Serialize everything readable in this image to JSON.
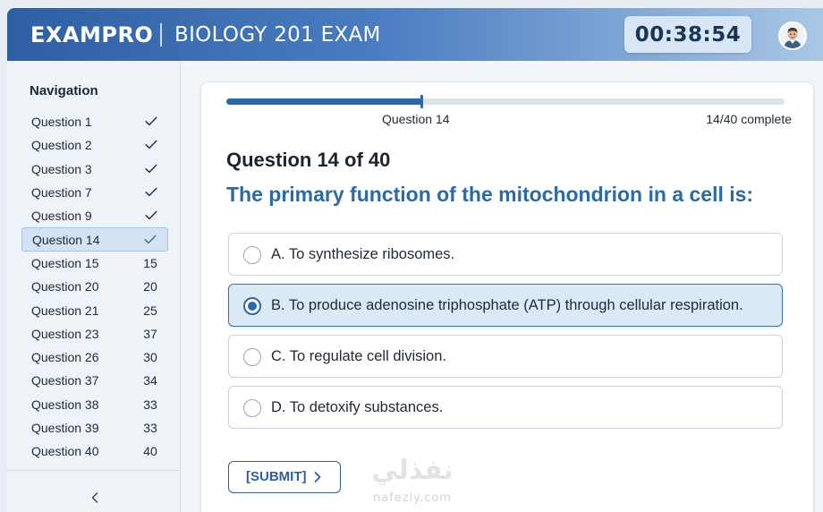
{
  "header": {
    "brand": "EXAMPRO",
    "exam_title": "BIOLOGY 201 EXAM",
    "timer": "00:38:54"
  },
  "sidebar": {
    "title": "Navigation",
    "items": [
      {
        "label": "Question 1",
        "status": "check",
        "value": ""
      },
      {
        "label": "Question 2",
        "status": "check",
        "value": ""
      },
      {
        "label": "Question 3",
        "status": "check",
        "value": ""
      },
      {
        "label": "Question 7",
        "status": "check",
        "value": ""
      },
      {
        "label": "Question 9",
        "status": "check",
        "value": ""
      },
      {
        "label": "Question 14",
        "status": "check",
        "value": "",
        "active": true
      },
      {
        "label": "Question 15",
        "status": "number",
        "value": "15"
      },
      {
        "label": "Question 20",
        "status": "number",
        "value": "20"
      },
      {
        "label": "Question 21",
        "status": "number",
        "value": "25"
      },
      {
        "label": "Question 23",
        "status": "number",
        "value": "37"
      },
      {
        "label": "Question 26",
        "status": "number",
        "value": "30"
      },
      {
        "label": "Question 37",
        "status": "number",
        "value": "34"
      },
      {
        "label": "Question 38",
        "status": "number",
        "value": "33"
      },
      {
        "label": "Question 39",
        "status": "number",
        "value": "33"
      },
      {
        "label": "Question 40",
        "status": "number",
        "value": "40"
      }
    ],
    "collapse_icon": "chevron-left-icon"
  },
  "progress": {
    "label": "Question 14",
    "count_text": "14/40 complete",
    "fraction": 0.35
  },
  "question": {
    "number_text": "Question 14 of 40",
    "text": "The primary function of the mitochondrion in a cell is:",
    "options": [
      {
        "text": "A. To synthesize ribosomes.",
        "selected": false
      },
      {
        "text": "B. To produce adenosine triphosphate (ATP) through cellular respiration.",
        "selected": true
      },
      {
        "text": "C. To regulate cell division.",
        "selected": false
      },
      {
        "text": "D. To detoxify substances.",
        "selected": false
      }
    ]
  },
  "submit": {
    "label": "[SUBMIT]",
    "icon": "chevron-right-icon"
  },
  "watermark": {
    "arabic": "نفذلي",
    "latin": "nafezly.com"
  },
  "colors": {
    "accent": "#2f66a6",
    "question_text": "#2c6aa0",
    "header_start": "#2f5fa3",
    "selected_bg": "#dbe9f6"
  }
}
